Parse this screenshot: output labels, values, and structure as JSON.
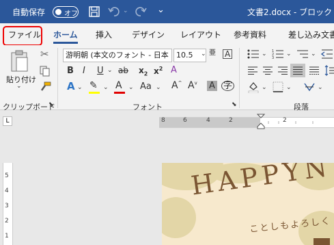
{
  "titlebar": {
    "autosave_label": "自動保存",
    "autosave_state": "オフ",
    "doc_title": "文書2.docx - ブロック",
    "qat_more": "⌄"
  },
  "tabs": [
    {
      "label": "ファイル"
    },
    {
      "label": "ホーム"
    },
    {
      "label": "挿入"
    },
    {
      "label": "デザイン"
    },
    {
      "label": "レイアウト"
    },
    {
      "label": "参考資料"
    },
    {
      "label": "差し込み文書"
    }
  ],
  "clipboard": {
    "paste_label": "貼り付け",
    "group_label": "クリップボード"
  },
  "font": {
    "font_name": "游明朝 (本文のフォント - 日本",
    "font_size": "10.5",
    "group_label": "フォント",
    "aa_label": "Aa"
  },
  "paragraph": {
    "group_label": "段落"
  },
  "ruler": {
    "h_nums": [
      "8",
      "6",
      "4",
      "2",
      "2"
    ],
    "v_nums": [
      "5",
      "4",
      "3",
      "2",
      "1"
    ],
    "corner": "L"
  },
  "document": {
    "happy": "HAPPYN",
    "greeting": "ことしもよろしく"
  }
}
